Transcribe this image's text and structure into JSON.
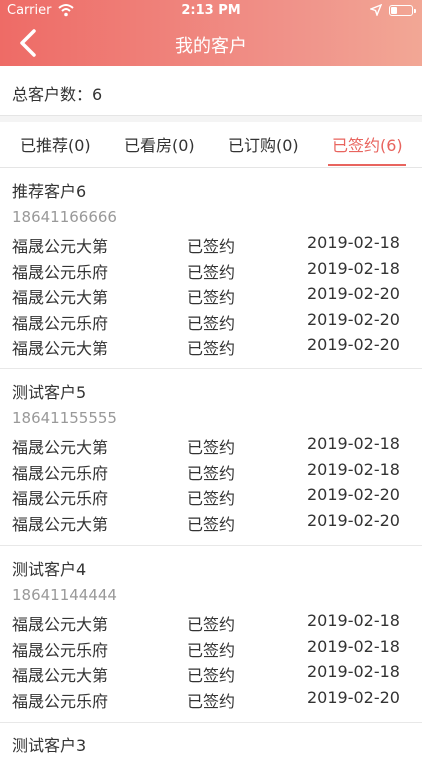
{
  "status_bar": {
    "carrier": "Carrier",
    "time": "2:13 PM"
  },
  "nav": {
    "title": "我的客户"
  },
  "summary": {
    "text": "总客户数：6"
  },
  "tabs": [
    {
      "label": "已推荐(0)"
    },
    {
      "label": "已看房(0)"
    },
    {
      "label": "已订购(0)"
    },
    {
      "label": "已签约(6)"
    }
  ],
  "customers": [
    {
      "name": "推荐客户6",
      "phone": "18641166666",
      "records": [
        {
          "project": "福晟公元大第",
          "status": "已签约",
          "date": "2019-02-18"
        },
        {
          "project": "福晟公元乐府",
          "status": "已签约",
          "date": "2019-02-18"
        },
        {
          "project": "福晟公元大第",
          "status": "已签约",
          "date": "2019-02-20"
        },
        {
          "project": "福晟公元乐府",
          "status": "已签约",
          "date": "2019-02-20"
        },
        {
          "project": "福晟公元大第",
          "status": "已签约",
          "date": "2019-02-20"
        }
      ]
    },
    {
      "name": "测试客户5",
      "phone": "18641155555",
      "records": [
        {
          "project": "福晟公元大第",
          "status": "已签约",
          "date": "2019-02-18"
        },
        {
          "project": "福晟公元乐府",
          "status": "已签约",
          "date": "2019-02-18"
        },
        {
          "project": "福晟公元乐府",
          "status": "已签约",
          "date": "2019-02-20"
        },
        {
          "project": "福晟公元大第",
          "status": "已签约",
          "date": "2019-02-20"
        }
      ]
    },
    {
      "name": "测试客户4",
      "phone": "18641144444",
      "records": [
        {
          "project": "福晟公元大第",
          "status": "已签约",
          "date": "2019-02-18"
        },
        {
          "project": "福晟公元乐府",
          "status": "已签约",
          "date": "2019-02-18"
        },
        {
          "project": "福晟公元大第",
          "status": "已签约",
          "date": "2019-02-18"
        },
        {
          "project": "福晟公元乐府",
          "status": "已签约",
          "date": "2019-02-20"
        }
      ]
    },
    {
      "name": "测试客户3",
      "phone": "",
      "records": []
    }
  ]
}
